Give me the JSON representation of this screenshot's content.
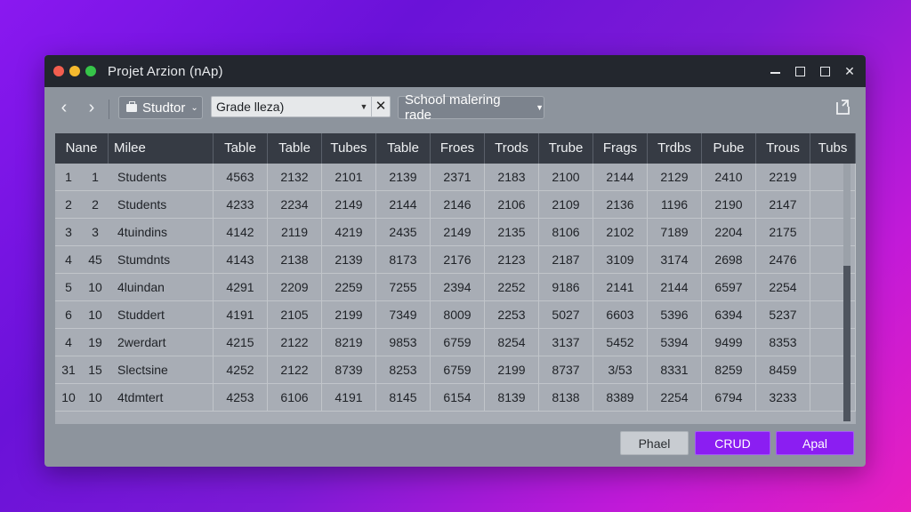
{
  "window": {
    "title": "Projet Arzion (nAp)"
  },
  "toolbar": {
    "back_label": "‹",
    "forward_label": "›",
    "student_button": "Studtor",
    "grade_field_value": "Grade lleza)",
    "school_select": "School malering rade"
  },
  "table": {
    "columns": [
      "Nane",
      "Milee",
      "Table",
      "Table",
      "Tubes",
      "Table",
      "Froes",
      "Trods",
      "Trube",
      "Frags",
      "Trdbs",
      "Pube",
      "Trous",
      "Tubs"
    ],
    "rows": [
      [
        "1",
        "1",
        "Students",
        "4563",
        "2132",
        "2101",
        "2139",
        "2371",
        "2183",
        "2100",
        "2144",
        "2129",
        "2410",
        "2219",
        ""
      ],
      [
        "2",
        "2",
        "Students",
        "4233",
        "2234",
        "2149",
        "2144",
        "2146",
        "2106",
        "2109",
        "2136",
        "1196",
        "2190",
        "2147",
        ""
      ],
      [
        "3",
        "3",
        "4tuindins",
        "4142",
        "2119",
        "4219",
        "2435",
        "2149",
        "2135",
        "8106",
        "2102",
        "7189",
        "2204",
        "2175",
        ""
      ],
      [
        "4",
        "45",
        "Stumdnts",
        "4143",
        "2138",
        "2139",
        "8173",
        "2176",
        "2123",
        "2187",
        "3109",
        "3174",
        "2698",
        "2476",
        ""
      ],
      [
        "5",
        "10",
        "4luindan",
        "4291",
        "2209",
        "2259",
        "7255",
        "2394",
        "2252",
        "9186",
        "2141",
        "2144",
        "6597",
        "2254",
        ""
      ],
      [
        "6",
        "10",
        "Studdert",
        "4191",
        "2105",
        "2199",
        "7349",
        "8009",
        "2253",
        "5027",
        "6603",
        "5396",
        "6394",
        "5237",
        ""
      ],
      [
        "4",
        "19",
        "2werdart",
        "4215",
        "2122",
        "8219",
        "9853",
        "6759",
        "8254",
        "3137",
        "5452",
        "5394",
        "9499",
        "8353",
        ""
      ],
      [
        "31",
        "15",
        "Slectsine",
        "4252",
        "2122",
        "8739",
        "8253",
        "6759",
        "2199",
        "8737",
        "3/53",
        "8331",
        "8259",
        "8459",
        ""
      ],
      [
        "10",
        "10",
        "4tdmtert",
        "4253",
        "6106",
        "4191",
        "8145",
        "6154",
        "8139",
        "8138",
        "8389",
        "2254",
        "6794",
        "3233",
        ""
      ]
    ]
  },
  "footer": {
    "phael_label": "Phael",
    "crud_label": "CRUD",
    "apal_label": "Apal"
  },
  "colors": {
    "accent": "#8b1ef2",
    "titlebar": "#23272e",
    "header": "#363b44"
  }
}
